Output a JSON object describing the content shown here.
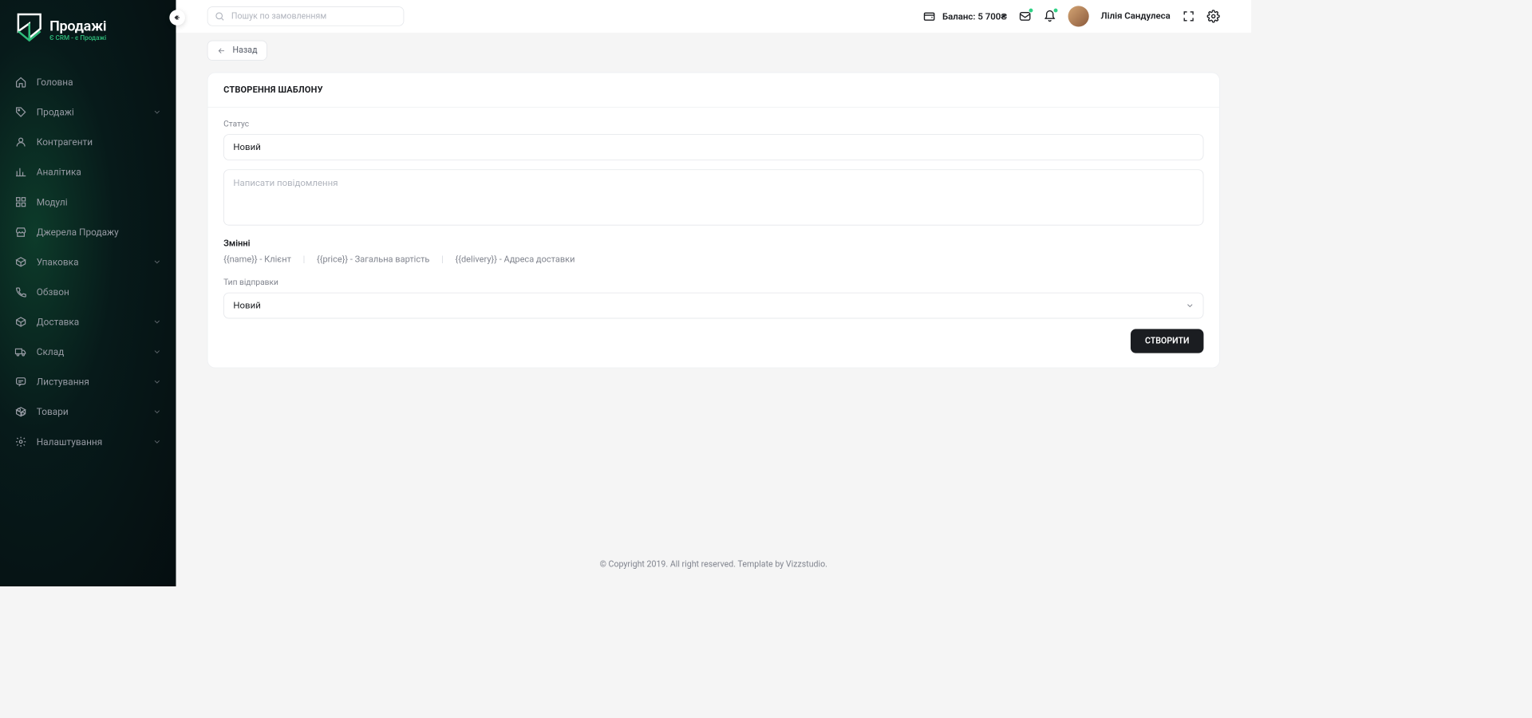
{
  "logo": {
    "title": "Продажі",
    "subtitle": "Є CRM - є Продажі"
  },
  "sidebar": {
    "items": [
      {
        "label": "Головна",
        "icon": "home",
        "expandable": false
      },
      {
        "label": "Продажі",
        "icon": "tag",
        "expandable": true
      },
      {
        "label": "Контрагенти",
        "icon": "user",
        "expandable": false
      },
      {
        "label": "Аналітика",
        "icon": "chart",
        "expandable": false
      },
      {
        "label": "Модулі",
        "icon": "grid",
        "expandable": false
      },
      {
        "label": "Джерела Продажу",
        "icon": "store",
        "expandable": false
      },
      {
        "label": "Упаковка",
        "icon": "box",
        "expandable": true
      },
      {
        "label": "Обзвон",
        "icon": "phone",
        "expandable": false
      },
      {
        "label": "Доставка",
        "icon": "cube",
        "expandable": true
      },
      {
        "label": "Склад",
        "icon": "truck",
        "expandable": true
      },
      {
        "label": "Листування",
        "icon": "chat",
        "expandable": true
      },
      {
        "label": "Товари",
        "icon": "package",
        "expandable": true
      },
      {
        "label": "Налаштування",
        "icon": "gear",
        "expandable": true
      }
    ]
  },
  "topbar": {
    "search_placeholder": "Пошук по замовленням",
    "balance_label": "Баланс: 5 700₴",
    "username": "Лілія Сандулеса"
  },
  "back_label": "Назад",
  "card": {
    "title": "СТВОРЕННЯ ШАБЛОНУ",
    "status_label": "Статус",
    "status_value": "Новий",
    "message_placeholder": "Написати повідомлення",
    "vars_title": "Змінні",
    "vars": [
      "{{name}} - Клієнт",
      "{{price}} - Загальна вартість",
      "{{delivery}} - Адреса доставки"
    ],
    "send_type_label": "Тип відправки",
    "send_type_value": "Новий",
    "submit_label": "СТВОРИТИ"
  },
  "footer": "© Copyright 2019. All right reserved. Template by Vizzstudio."
}
